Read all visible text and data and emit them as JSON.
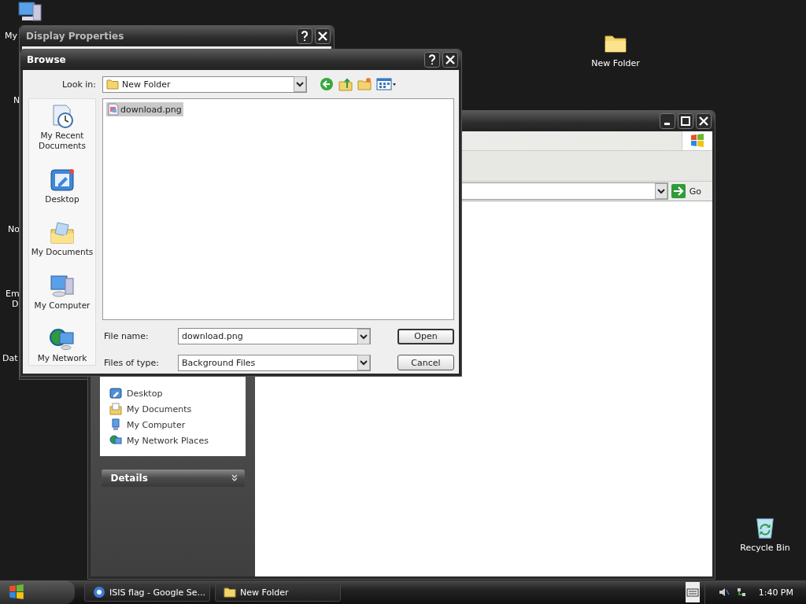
{
  "desktop": {
    "cut_labels": [
      "My",
      "N",
      "No",
      "Em",
      "D",
      "Dat"
    ],
    "icons": [
      {
        "label": "New Folder",
        "kind": "folder"
      },
      {
        "label": "Recycle Bin",
        "kind": "recycle"
      }
    ]
  },
  "display_properties": {
    "title": "Display Properties"
  },
  "explorer": {
    "go_label": "Go",
    "other_places": [
      {
        "label": "Desktop",
        "kind": "desktop"
      },
      {
        "label": "My Documents",
        "kind": "documents"
      },
      {
        "label": "My Computer",
        "kind": "computer"
      },
      {
        "label": "My Network Places",
        "kind": "network"
      }
    ],
    "details_title": "Details"
  },
  "browse": {
    "title": "Browse",
    "look_in_label": "Look in:",
    "look_in_value": "New Folder",
    "places": [
      {
        "label": "My Recent Documents",
        "kind": "recent"
      },
      {
        "label": "Desktop",
        "kind": "desktop"
      },
      {
        "label": "My Documents",
        "kind": "documents"
      },
      {
        "label": "My Computer",
        "kind": "computer"
      },
      {
        "label": "My Network",
        "kind": "network"
      }
    ],
    "files": [
      {
        "name": "download.png",
        "selected": true
      }
    ],
    "file_name_label": "File name:",
    "file_name_value": "download.png",
    "file_type_label": "Files of type:",
    "file_type_value": "Background Files",
    "buttons": [
      {
        "label": "Open",
        "kind": "open"
      },
      {
        "label": "Cancel",
        "kind": "cancel"
      }
    ]
  },
  "taskbar": {
    "tasks": [
      {
        "label": "ISIS flag - Google Se...",
        "kind": "browser"
      },
      {
        "label": "New Folder",
        "kind": "folder"
      }
    ],
    "clock": "1:40 PM"
  }
}
